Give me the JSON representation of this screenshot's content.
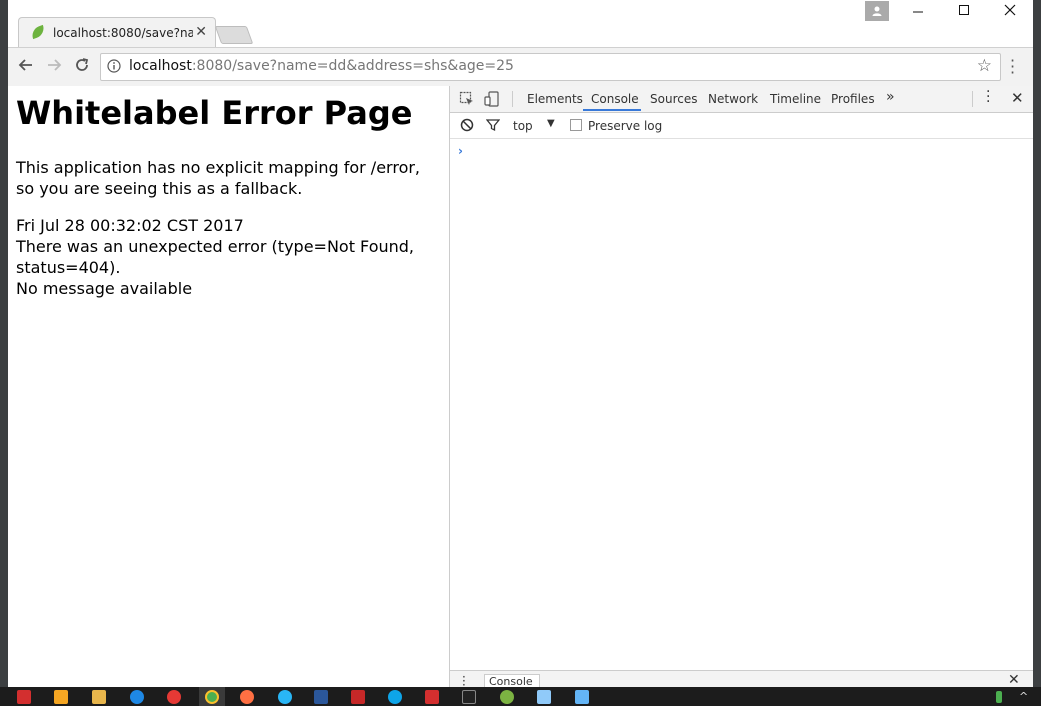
{
  "browser": {
    "tab_title": "localhost:8080/save?na",
    "url_host": "localhost",
    "url_rest": ":8080/save?name=dd&address=shs&age=25"
  },
  "page": {
    "heading": "Whitelabel Error Page",
    "paragraph1": "This application has no explicit mapping for /error, so you are seeing this as a fallback.",
    "timestamp": "Fri Jul 28 00:32:02 CST 2017",
    "error_line": "There was an unexpected error (type=Not Found, status=404).",
    "message": "No message available"
  },
  "devtools": {
    "tabs": [
      "Elements",
      "Console",
      "Sources",
      "Network",
      "Timeline",
      "Profiles"
    ],
    "active_tab": "Console",
    "context": "top",
    "preserve_log_label": "Preserve log",
    "prompt": "›",
    "drawer_tab": "Console"
  },
  "colors": {
    "accent": "#3879d9",
    "spring_leaf": "#6db33f"
  }
}
